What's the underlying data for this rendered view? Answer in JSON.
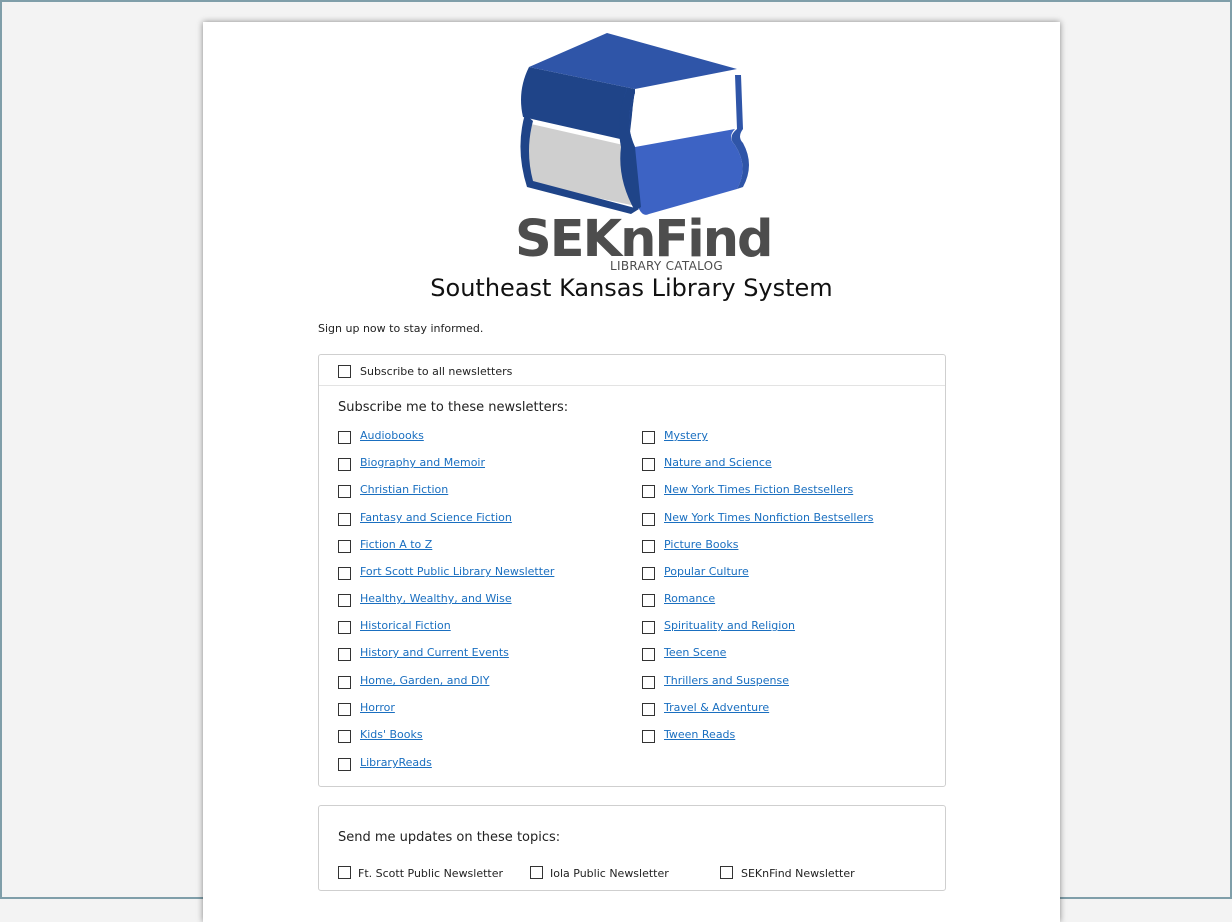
{
  "logo": {
    "wordmark": "SEKnFind",
    "tagline": "LIBRARY CATALOG",
    "colors": {
      "book_dark": "#1f4488",
      "book_mid": "#2f55a8",
      "book_light": "#3d63c4",
      "pages": "#d0d0d0",
      "text": "#4d4d4d"
    }
  },
  "site_title": "Southeast Kansas Library System",
  "intro": "Sign up now to stay informed.",
  "subscribe_all": "Subscribe to all newsletters",
  "newsletters_heading": "Subscribe me to these newsletters:",
  "newsletters_left": [
    "Audiobooks",
    "Biography and Memoir",
    "Christian Fiction",
    "Fantasy and Science Fiction",
    "Fiction A to Z",
    "Fort Scott Public Library Newsletter",
    "Healthy, Wealthy, and Wise",
    "Historical Fiction",
    "History and Current Events",
    "Home, Garden, and DIY",
    "Horror",
    "Kids' Books",
    "LibraryReads"
  ],
  "newsletters_right": [
    "Mystery",
    "Nature and Science",
    "New York Times Fiction Bestsellers",
    "New York Times Nonfiction Bestsellers",
    "Picture Books",
    "Popular Culture",
    "Romance",
    "Spirituality and Religion",
    "Teen Scene",
    "Thrillers and Suspense",
    "Travel & Adventure",
    "Tween Reads"
  ],
  "topics_heading": "Send me updates on these topics:",
  "topics": [
    "Ft. Scott Public Newsletter",
    "Iola Public Newsletter",
    "SEKnFind Newsletter"
  ],
  "colors": {
    "link": "#1a6fc0",
    "frame": "#7f9ea9"
  }
}
